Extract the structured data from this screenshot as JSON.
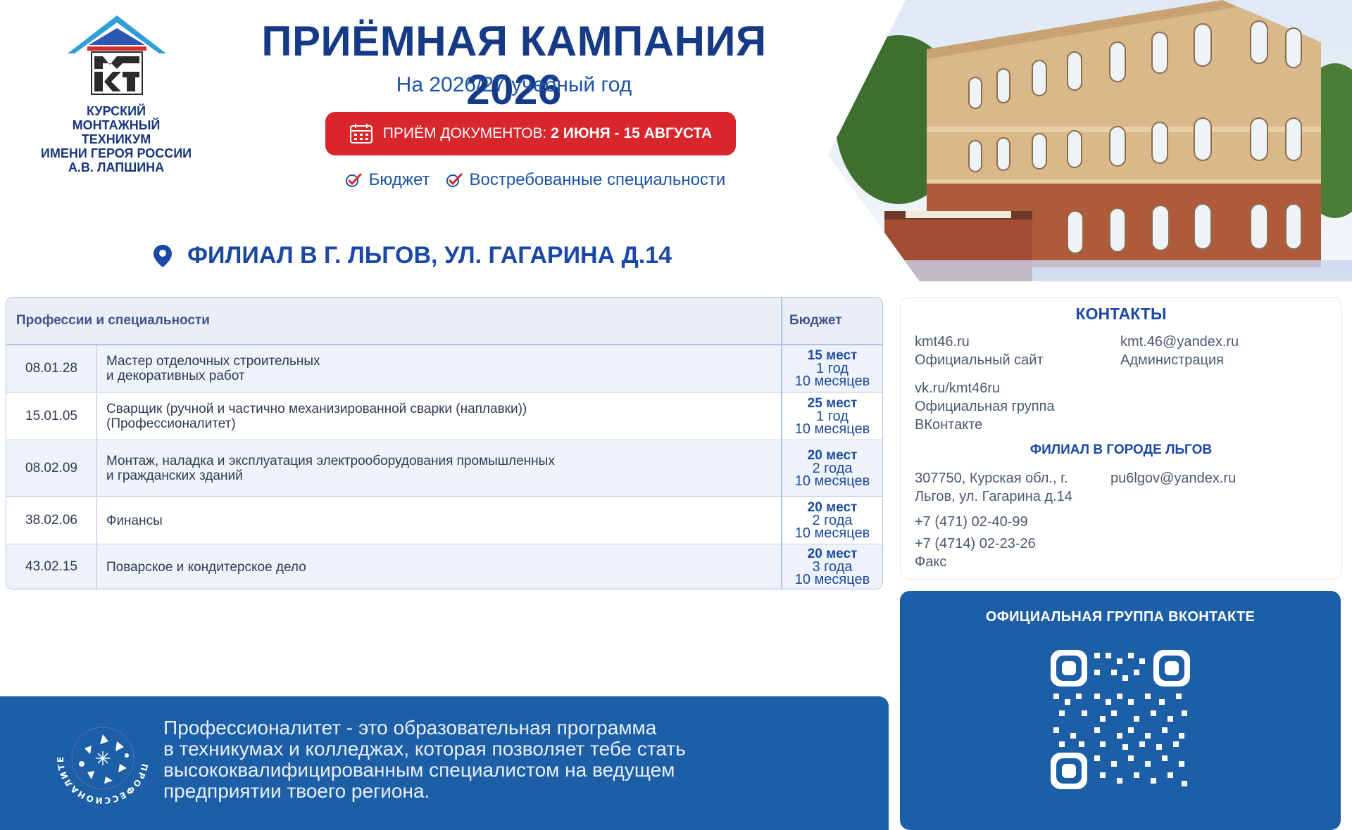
{
  "logo": {
    "text": "КУРСКИЙ\nМОНТАЖНЫЙ\nТЕХНИКУМ\nИМЕНИ ГЕРОЯ РОССИИ\nА.В. ЛАПШИНА",
    "icon": "kmt-house-logo-icon"
  },
  "header": {
    "title": "ПРИЁМНАЯ КАМПАНИЯ 2026",
    "subtitle": "На 2026/27 учебный год",
    "dates_prefix": "ПРИЁМ ДОКУМЕНТОВ:",
    "dates_value": "2 ИЮНЯ - 15 АВГУСТА",
    "tags": [
      "Бюджет",
      "Востребованные специальности"
    ]
  },
  "branch": {
    "label": "ФИЛИАЛ В Г. ЛЬГОВ, УЛ. ГАГАРИНА Д.14"
  },
  "table": {
    "headers": [
      "Профессии и специальности",
      "Бюджет"
    ],
    "rows": [
      {
        "code": "08.01.28",
        "name": "Мастер отделочных строительных\nи декоративных работ",
        "places": "15 мест",
        "duration1": "1 год",
        "duration2": "10 месяцев"
      },
      {
        "code": "15.01.05",
        "name": "Сварщик (ручной и частично механизированной сварки (наплавки))\n(Профессионалитет)",
        "places": "25 мест",
        "duration1": "1 год",
        "duration2": "10 месяцев"
      },
      {
        "code": "08.02.09",
        "name": "Монтаж, наладка и эксплуатация электрооборудования промышленных\nи гражданских зданий",
        "places": "20 мест",
        "duration1": "2 года",
        "duration2": "10 месяцев"
      },
      {
        "code": "38.02.06",
        "name": "Финансы",
        "places": "20 мест",
        "duration1": "2 года",
        "duration2": "10 месяцев"
      },
      {
        "code": "43.02.15",
        "name": "Поварское и кондитерское дело",
        "places": "20 мест",
        "duration1": "3 года",
        "duration2": "10 месяцев"
      }
    ]
  },
  "contacts": {
    "title": "КОНТАКТЫ",
    "site": "kmt46.ru\nОфициальный  сайт",
    "email": "kmt.46@yandex.ru\nАдминистрация",
    "vk": "vk.ru/kmt46ru\nОфициальная группа\nВКонтакте",
    "branch_title": "ФИЛИАЛ В ГОРОДЕ ЛЬГОВ",
    "branch_address": "307750, Курская обл., г.\nЛьгов, ул. Гагарина д.14",
    "branch_email": "pu6lgov@yandex.ru",
    "phone1": "+7 (471) 02-40-99",
    "phone2": "+7 (4714) 02-23-26\nФакс"
  },
  "vk_card": {
    "title": "ОФИЦИАЛЬНАЯ ГРУППА ВКОНТАКТЕ"
  },
  "banner": {
    "text": "Профессионалитет - это образовательная программа\nв техникумах и колледжах, которая позволяет тебе стать\nвысококвалифицированным специалистом на ведущем\nпредприятии твоего региона.",
    "logo_text": "ПРОФЕССИОНАЛИТЕТ"
  },
  "colors": {
    "primary_blue": "#1d5fa7",
    "title_blue": "#153a86",
    "accent_red": "#d8262b",
    "table_border": "#b3c4e3"
  }
}
